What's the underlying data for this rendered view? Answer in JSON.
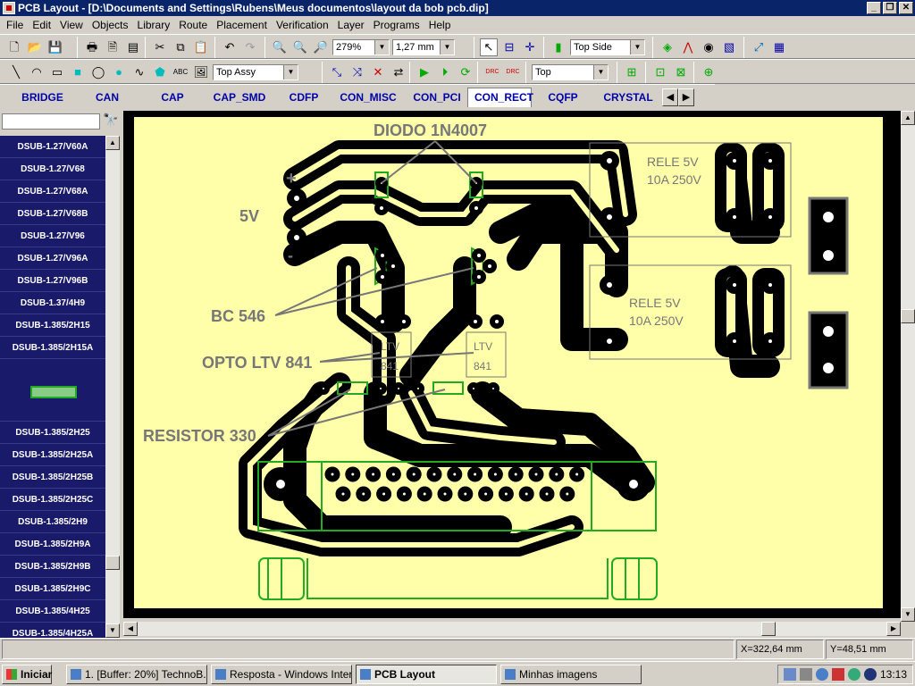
{
  "window": {
    "title": "PCB Layout - [D:\\Documents and Settings\\Rubens\\Meus documentos\\layout da bob pcb.dip]",
    "btn_min": "_",
    "btn_max": "❐",
    "btn_close": "✕"
  },
  "menu": [
    "File",
    "Edit",
    "View",
    "Objects",
    "Library",
    "Route",
    "Placement",
    "Verification",
    "Layer",
    "Programs",
    "Help"
  ],
  "toolbar": {
    "zoom_value": "279%",
    "grid_value": "1,27 mm",
    "side_value": "Top Side",
    "text_glyph": "ABC",
    "drc_glyph": "DRC",
    "layer_assy": "Top Assy",
    "layer_top": "Top"
  },
  "library_tabs": [
    {
      "label": "BRIDGE",
      "active": false
    },
    {
      "label": "CAN",
      "active": false
    },
    {
      "label": "CAP",
      "active": false
    },
    {
      "label": "CAP_SMD",
      "active": false
    },
    {
      "label": "CDFP",
      "active": false
    },
    {
      "label": "CON_MISC",
      "active": false
    },
    {
      "label": "CON_PCI",
      "active": false
    },
    {
      "label": "CON_RECT",
      "active": true
    },
    {
      "label": "CQFP",
      "active": false
    },
    {
      "label": "CRYSTAL",
      "active": false
    }
  ],
  "sidebar_items_top": [
    "DSUB-1.27/V60A",
    "DSUB-1.27/V68",
    "DSUB-1.27/V68A",
    "DSUB-1.27/V68B",
    "DSUB-1.27/V96",
    "DSUB-1.27/V96A",
    "DSUB-1.27/V96B",
    "DSUB-1.37/4H9",
    "DSUB-1.385/2H15",
    "DSUB-1.385/2H15A"
  ],
  "sidebar_items_bottom": [
    "DSUB-1.385/2H25",
    "DSUB-1.385/2H25A",
    "DSUB-1.385/2H25B",
    "DSUB-1.385/2H25C",
    "DSUB-1.385/2H9",
    "DSUB-1.385/2H9A",
    "DSUB-1.385/2H9B",
    "DSUB-1.385/2H9C",
    "DSUB-1.385/4H25",
    "DSUB-1.385/4H25A"
  ],
  "board_labels": {
    "diodo": "DIODO 1N4007",
    "v5": "5V",
    "plus": "+",
    "minus": "-",
    "bc546": "BC 546",
    "opto": "OPTO LTV 841",
    "resistor": "RESISTOR 330",
    "rele1_a": "RELE 5V",
    "rele1_b": "10A  250V",
    "rele2_a": "RELE 5V",
    "rele2_b": "10A  250V",
    "ltv1_a": "LTV",
    "ltv1_b": "841",
    "ltv2_a": "LTV",
    "ltv2_b": "841"
  },
  "status": {
    "x": "X=322,64 mm",
    "y": "Y=48,51 mm"
  },
  "taskbar": {
    "start": "Iniciar",
    "tasks": [
      {
        "label": "1. [Buffer: 20%] TechnoB...",
        "active": false
      },
      {
        "label": "Resposta - Windows Inter...",
        "active": false
      },
      {
        "label": "PCB Layout",
        "active": true
      },
      {
        "label": "Minhas imagens",
        "active": false
      }
    ],
    "clock": "13:13"
  }
}
